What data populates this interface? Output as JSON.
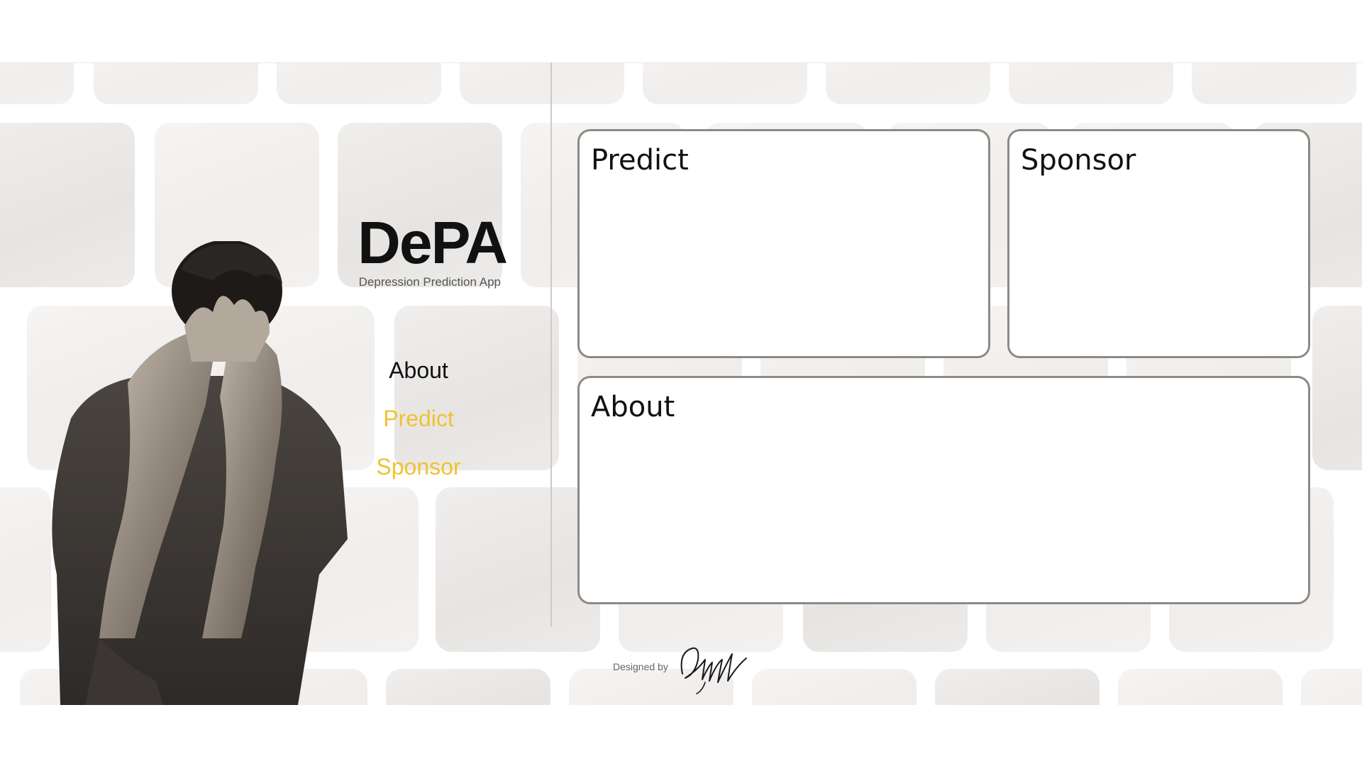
{
  "brand": {
    "title": "DePA",
    "subtitle": "Depression Prediction App"
  },
  "nav": {
    "items": [
      {
        "label": "About",
        "active": true
      },
      {
        "label": "Predict",
        "active": false
      },
      {
        "label": "Sponsor",
        "active": false
      }
    ],
    "active_color": "#111111",
    "inactive_color": "#f0c232"
  },
  "cards": {
    "predict": {
      "title": "Predict"
    },
    "sponsor": {
      "title": "Sponsor"
    },
    "about": {
      "title": "About"
    }
  },
  "footer": {
    "designed_by_label": "Designed by",
    "signature_text": "DilipNaidu"
  },
  "colors": {
    "card_border": "#8e8984",
    "accent": "#f0c232"
  }
}
